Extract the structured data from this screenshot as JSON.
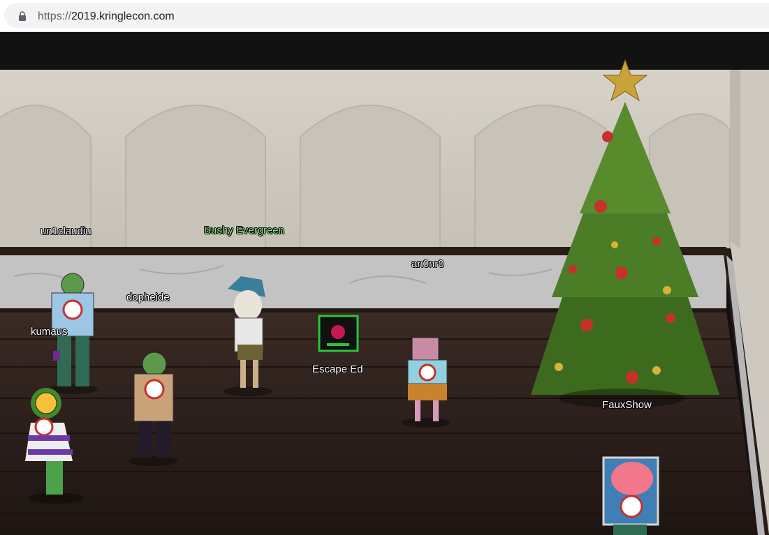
{
  "browser": {
    "url_scheme": "https://",
    "url_host": "2019.kringlecon.com"
  },
  "scene": {
    "players": [
      {
        "name": "un1claudiu"
      },
      {
        "name": "Bushy Evergreen"
      },
      {
        "name": "an0nr0"
      },
      {
        "name": "dopheide"
      },
      {
        "name": "kumaus"
      },
      {
        "name": "Escape Ed"
      },
      {
        "name": "FauxShow"
      }
    ]
  },
  "colors": {
    "wall": "#d2cec5",
    "floor": "#2e211c",
    "marble": "#bfbfbf",
    "tree": "#3d6b1e",
    "ribbon": "#c8302c",
    "player_name_npc": "#8ee07a"
  }
}
